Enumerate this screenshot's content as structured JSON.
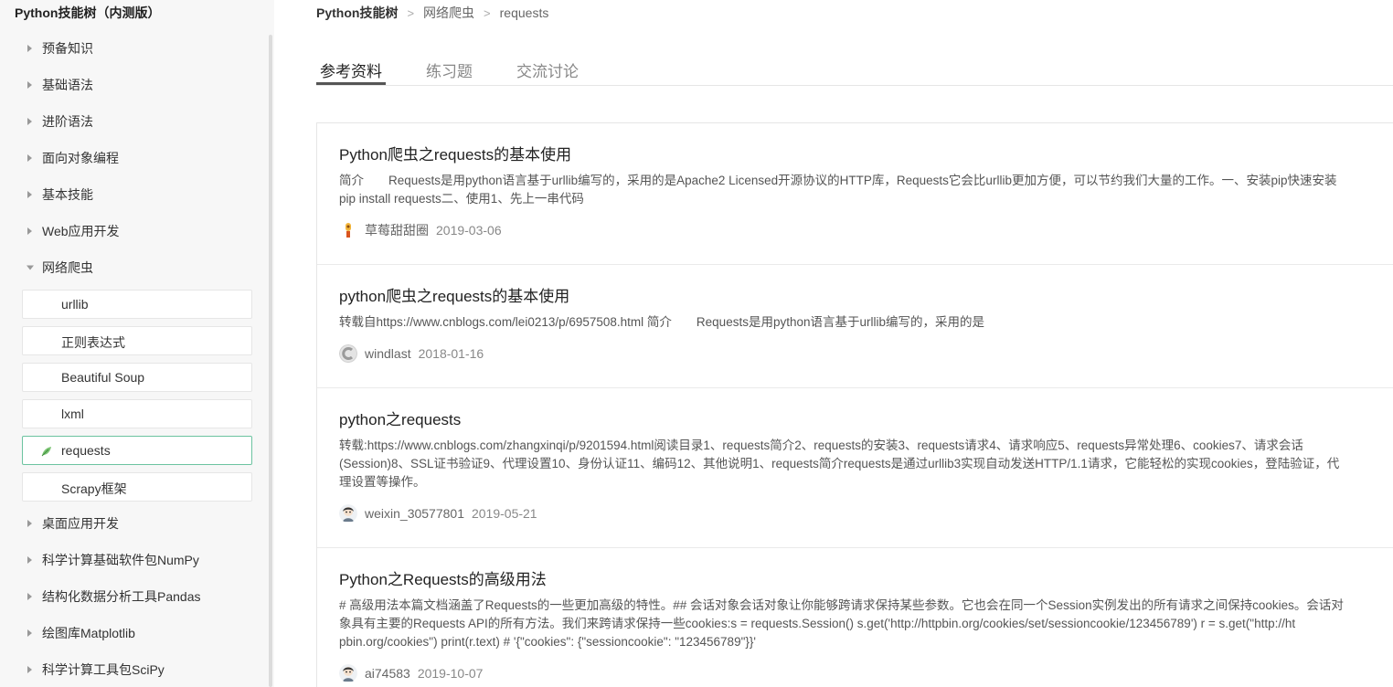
{
  "sidebar": {
    "title": "Python技能树（内测版）",
    "items": [
      {
        "label": "预备知识",
        "expanded": false
      },
      {
        "label": "基础语法",
        "expanded": false
      },
      {
        "label": "进阶语法",
        "expanded": false
      },
      {
        "label": "面向对象编程",
        "expanded": false
      },
      {
        "label": "基本技能",
        "expanded": false
      },
      {
        "label": "Web应用开发",
        "expanded": false
      },
      {
        "label": "网络爬虫",
        "expanded": true
      },
      {
        "label": "桌面应用开发",
        "expanded": false
      },
      {
        "label": "科学计算基础软件包NumPy",
        "expanded": false
      },
      {
        "label": "结构化数据分析工具Pandas",
        "expanded": false
      },
      {
        "label": "绘图库Matplotlib",
        "expanded": false
      },
      {
        "label": "科学计算工具包SciPy",
        "expanded": false
      }
    ],
    "children": [
      {
        "label": "urllib"
      },
      {
        "label": "正则表达式"
      },
      {
        "label": "Beautiful Soup"
      },
      {
        "label": "lxml"
      },
      {
        "label": "requests",
        "active": true
      },
      {
        "label": "Scrapy框架"
      }
    ]
  },
  "breadcrumb": {
    "root": "Python技能树",
    "level1": "网络爬虫",
    "level2": "requests"
  },
  "tabs": [
    {
      "label": "参考资料",
      "active": true
    },
    {
      "label": "练习题",
      "active": false
    },
    {
      "label": "交流讨论",
      "active": false
    }
  ],
  "articles": [
    {
      "title": "Python爬虫之requests的基本使用",
      "desc": " 简介　　Requests是用python语言基于urllib编写的，采用的是Apache2 Licensed开源协议的HTTP库，Requests它会比urllib更加方便，可以节约我们大量的工作。一、安装pip快速安装\npip install requests二、使用1、先上一串代码",
      "author": "草莓甜甜圈",
      "date": "2019-03-06",
      "avatar_icon": "cartoon-avatar-icon"
    },
    {
      "title": "python爬虫之requests的基本使用",
      "desc": "转载自https://www.cnblogs.com/lei0213/p/6957508.html 简介　　Requests是用python语言基于urllib编写的，采用的是",
      "author": "windlast",
      "date": "2018-01-16",
      "avatar_icon": "default-avatar-icon"
    },
    {
      "title": "python之requests",
      "desc": "转载:https://www.cnblogs.com/zhangxinqi/p/9201594.html阅读目录1、requests简介2、requests的安装3、requests请求4、请求响应5、requests异常处理6、cookies7、请求会话\n(Session)8、SSL证书验证9、代理设置10、身份认证11、编码12、其他说明1、requests简介requests是通过urllib3实现自动发送HTTP/1.1请求，它能轻松的实现cookies，登陆验证，代\n理设置等操作。",
      "author": "weixin_30577801",
      "date": "2019-05-21",
      "avatar_icon": "user-avatar-icon"
    },
    {
      "title": "Python之Requests的高级用法",
      "desc": "# 高级用法本篇文档涵盖了Requests的一些更加高级的特性。## 会话对象会话对象让你能够跨请求保持某些参数。它也会在同一个Session实例发出的所有请求之间保持cookies。会话对\n象具有主要的Requests API的所有方法。我们来跨请求保持一些cookies:s = requests.Session() s.get('http://httpbin.org/cookies/set/sessioncookie/123456789') r = s.get(\"http://ht\npbin.org/cookies\") print(r.text) # '{\"cookies\": {\"sessioncookie\": \"123456789\"}}'",
      "author": "ai74583",
      "date": "2019-10-07",
      "avatar_icon": "user-avatar-icon"
    }
  ],
  "colors": {
    "sidebar_bg": "#f7f7f7",
    "active_border": "#6cc3a0",
    "leaf_green": "#4caf50"
  }
}
